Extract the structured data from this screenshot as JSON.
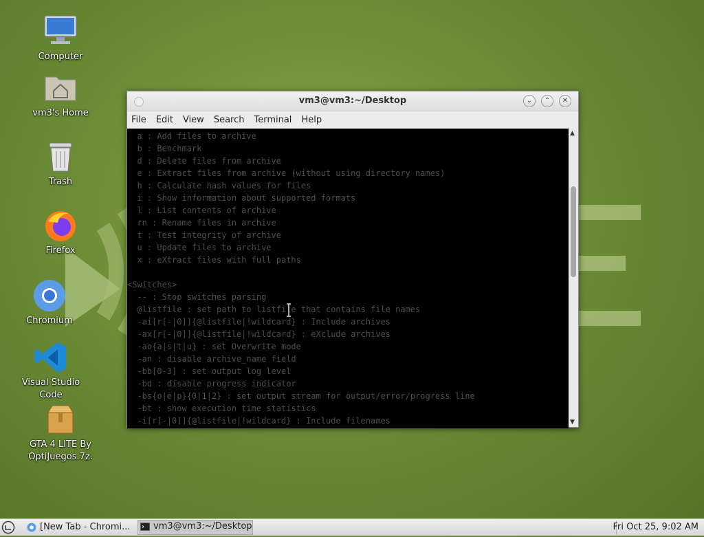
{
  "desktop": {
    "icons": [
      {
        "label": "Computer"
      },
      {
        "label": "vm3's Home"
      },
      {
        "label": "Trash"
      },
      {
        "label": "Firefox"
      },
      {
        "label": "Chromium"
      },
      {
        "label": "Visual Studio Code"
      },
      {
        "label": "GTA 4 LITE By\nOptiJuegos.7z."
      }
    ]
  },
  "window": {
    "title": "vm3@vm3:~/Desktop",
    "menu": [
      "File",
      "Edit",
      "View",
      "Search",
      "Terminal",
      "Help"
    ],
    "buttons": {
      "minimize": "⌄",
      "maximize": "⌃",
      "close": "✕"
    }
  },
  "terminal": {
    "lines": [
      "  a : Add files to archive",
      "  b : Benchmark",
      "  d : Delete files from archive",
      "  e : Extract files from archive (without using directory names)",
      "  h : Calculate hash values for files",
      "  i : Show information about supported formats",
      "  l : List contents of archive",
      "  rn : Rename files in archive",
      "  t : Test integrity of archive",
      "  u : Update files to archive",
      "  x : eXtract files with full paths",
      "",
      "<Switches>",
      "  -- : Stop switches parsing",
      "  @listfile : set path to listfile that contains file names",
      "  -ai[r[-|0]]{@listfile|!wildcard} : Include archives",
      "  -ax[r[-|0]]{@listfile|!wildcard} : eXclude archives",
      "  -ao{a|s|t|u} : set Overwrite mode",
      "  -an : disable archive_name field",
      "  -bb[0-3] : set output log level",
      "  -bd : disable progress indicator",
      "  -bs{o|e|p}{0|1|2} : set output stream for output/error/progress line",
      "  -bt : show execution time statistics",
      "  -i[r[-|0]]{@listfile|!wildcard} : Include filenames"
    ]
  },
  "taskbar": {
    "items": [
      {
        "label": "[New Tab - Chromi...",
        "active": false
      },
      {
        "label": "vm3@vm3:~/Desktop",
        "active": true
      }
    ],
    "clock": "Fri Oct 25,  9:02 AM"
  },
  "colors": {
    "wallpaper": "#6c8c36",
    "terminal_bg": "#000000",
    "terminal_fg": "#4d4d4d"
  }
}
